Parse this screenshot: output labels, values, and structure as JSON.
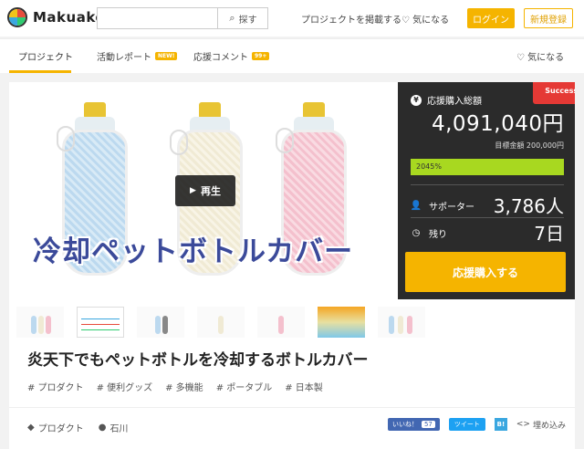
{
  "header": {
    "logo_text": "Makuake",
    "search_placeholder": "",
    "search_button": "探す",
    "post_project": "プロジェクトを掲載する",
    "favorites": "気になる",
    "login": "ログイン",
    "signup": "新規登録"
  },
  "tabs": {
    "items": [
      {
        "label": "プロジェクト",
        "badge": ""
      },
      {
        "label": "活動レポート",
        "badge": "NEW!"
      },
      {
        "label": "応援コメント",
        "badge": "99+"
      }
    ],
    "favorite": "気になる"
  },
  "hero": {
    "play_label": "再生",
    "overlay_title": "冷却ペットボトルカバー"
  },
  "panel": {
    "success_badge": "Success!",
    "total_label": "応援購入総額",
    "amount": "4,091,040円",
    "goal": "目標金額 200,000円",
    "progress_text": "2045%",
    "progress_fraction": 1.0,
    "supporters_label": "サポーター",
    "supporters_value": "3,786人",
    "remaining_label": "残り",
    "remaining_value": "7日",
    "cta": "応援購入する"
  },
  "project": {
    "title": "炎天下でもペットボトルを冷却するボトルカバー",
    "tags": [
      "# プロダクト",
      "# 便利グッズ",
      "# 多機能",
      "# ポータブル",
      "# 日本製"
    ],
    "category": "プロダクト",
    "location": "石川"
  },
  "share": {
    "like": "いいね！",
    "like_count": "57",
    "tweet": "ツイート",
    "bi": "B!",
    "embed": "埋め込み"
  },
  "colors": {
    "accent": "#f5b400",
    "panel_bg": "#2b2b2b",
    "progress": "#a8d820",
    "success": "#e53935"
  }
}
